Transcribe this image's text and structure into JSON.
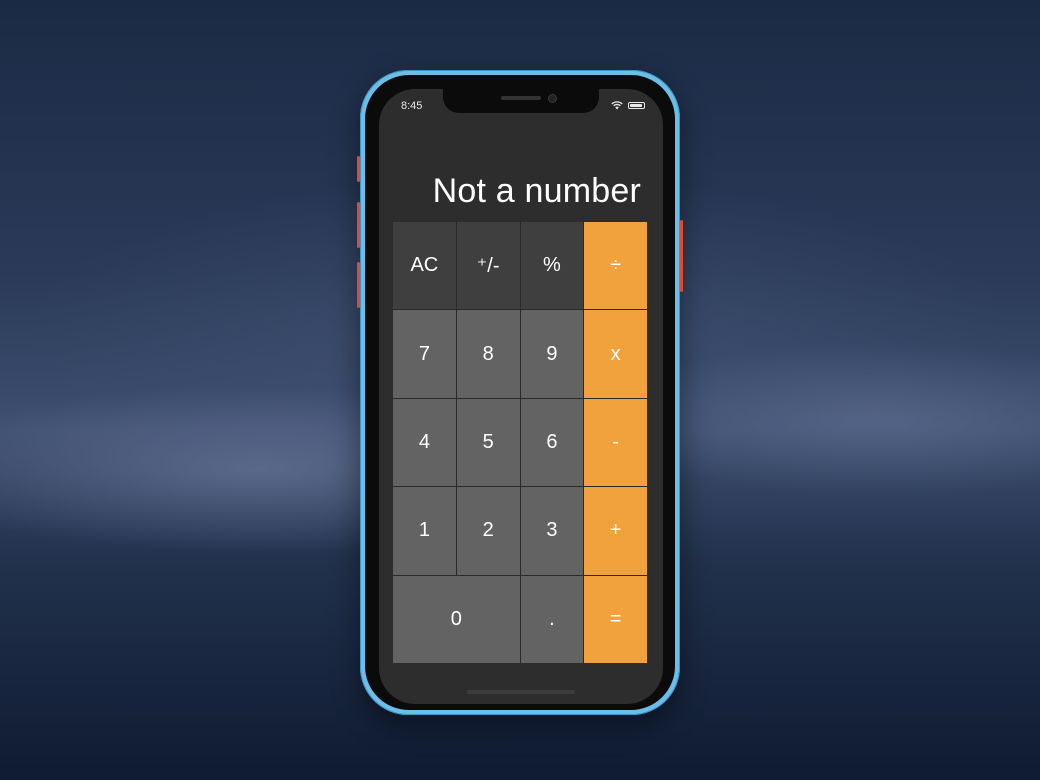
{
  "status_bar": {
    "time": "8:45"
  },
  "display": {
    "value": "Not a number"
  },
  "keypad": {
    "row1": [
      "AC",
      "⁺/-",
      "%",
      "÷"
    ],
    "row2": [
      "7",
      "8",
      "9",
      "x"
    ],
    "row3": [
      "4",
      "5",
      "6",
      "-"
    ],
    "row4": [
      "1",
      "2",
      "3",
      "+"
    ],
    "row5": [
      "0",
      ".",
      "="
    ]
  },
  "colors": {
    "function_key": "#3f3f3f",
    "number_key": "#636363",
    "operator_key": "#f2a23d",
    "screen_bg": "#2d2d2d",
    "phone_frame": "#6cbde8"
  },
  "icons": [
    "wifi-icon",
    "battery-icon",
    "camera-icon",
    "speaker-icon"
  ]
}
